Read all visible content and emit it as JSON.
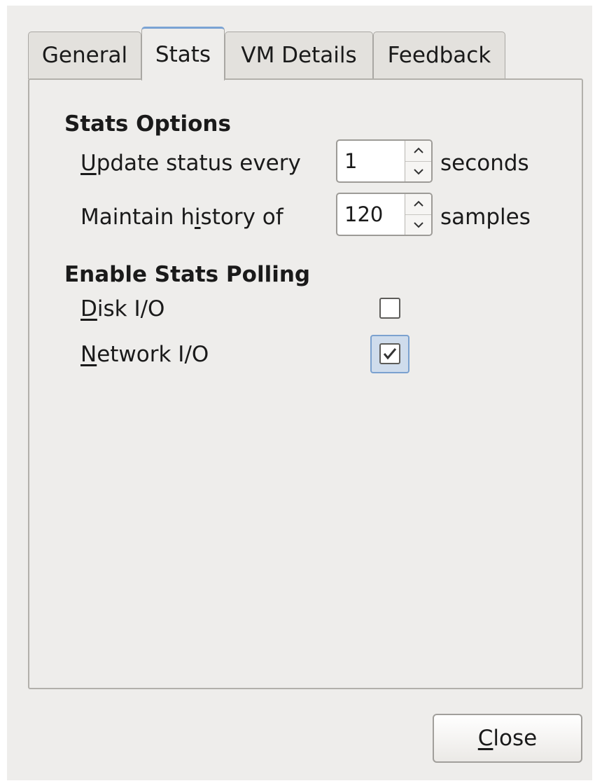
{
  "tabs": [
    {
      "label": "General",
      "active": false
    },
    {
      "label": "Stats",
      "active": true
    },
    {
      "label": "VM Details",
      "active": false
    },
    {
      "label": "Feedback",
      "active": false
    }
  ],
  "stats_options": {
    "title": "Stats Options",
    "update": {
      "label_mnemonic": "U",
      "label_rest": "pdate status every",
      "value": "1",
      "unit": "seconds"
    },
    "history": {
      "label_pre": "Maintain h",
      "label_mnemonic": "i",
      "label_post": "story of",
      "value": "120",
      "unit": "samples"
    }
  },
  "polling": {
    "title": "Enable Stats Polling",
    "disk": {
      "label_mnemonic": "D",
      "label_rest": "isk I/O",
      "checked": false
    },
    "network": {
      "label_mnemonic": "N",
      "label_rest": "etwork I/O",
      "checked": true
    }
  },
  "footer": {
    "close_mnemonic": "C",
    "close_rest": "lose"
  },
  "icons": {
    "spin_up": "chevron-up-icon",
    "spin_down": "chevron-down-icon",
    "check": "checkmark-icon"
  },
  "colors": {
    "accent": "#7aa3d4",
    "window_bg": "#eeedeb",
    "checkbox_highlight": "#cfdcec"
  }
}
